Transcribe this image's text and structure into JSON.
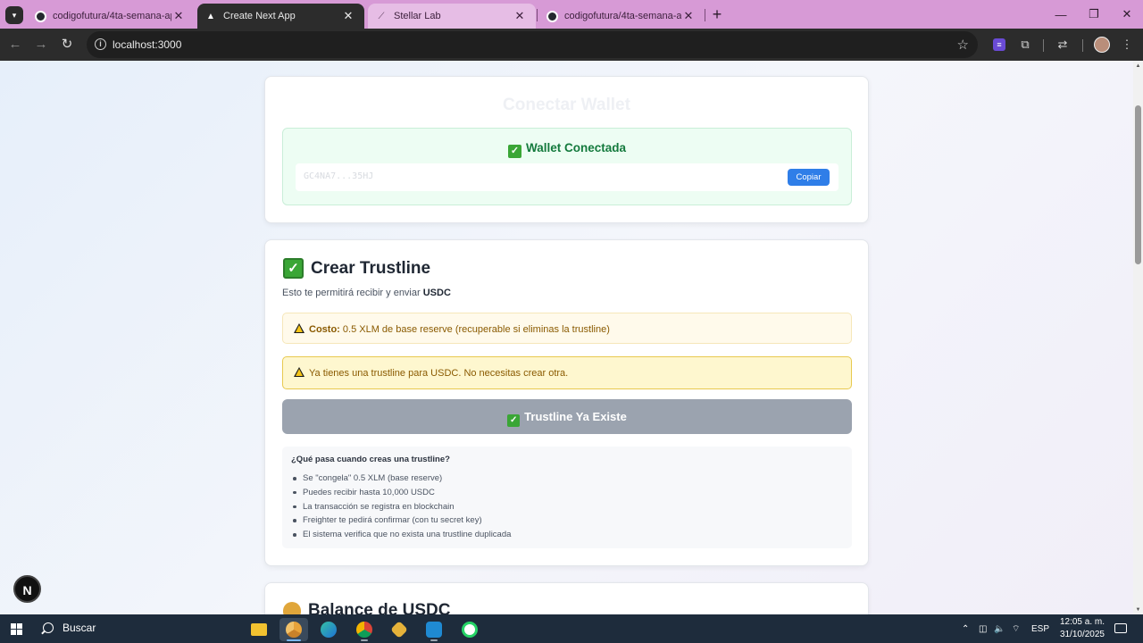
{
  "browser": {
    "tabs": [
      {
        "title": "codigofutura/4ta-semana-aplic",
        "favicon": "github-icon",
        "active": false
      },
      {
        "title": "Create Next App",
        "favicon": "nextjs-triangle-icon",
        "active": true
      },
      {
        "title": "Stellar Lab",
        "favicon": "stellar-icon",
        "active": false
      },
      {
        "title": "codigofutura/4ta-semana-aplic",
        "favicon": "github-icon",
        "active": false
      }
    ],
    "url": "localhost:3000"
  },
  "wallet_card": {
    "title": "Conectar Wallet",
    "status": "Wallet Conectada",
    "address": "GC4NA7...35HJ",
    "copy_label": "Copiar"
  },
  "trustline_card": {
    "title": "Crear Trustline",
    "subtitle_prefix": "Esto te permitirá recibir y enviar",
    "asset": "USDC",
    "cost_label": "Costo:",
    "cost_text": "0.5 XLM de base reserve (recuperable si eliminas la trustline)",
    "warning_text": "Ya tienes una trustline para USDC. No necesitas crear otra.",
    "button_label": "Trustline Ya Existe",
    "info_title": "¿Qué pasa cuando creas una trustline?",
    "info_items": [
      "Se \"congela\" 0.5 XLM (base reserve)",
      "Puedes recibir hasta 10,000 USDC",
      "La transacción se registra en blockchain",
      "Freighter te pedirá confirmar (con tu secret key)",
      "El sistema verifica que no exista una trustline duplicada"
    ]
  },
  "balance_card": {
    "title": "Balance de USDC"
  },
  "next_badge": "N",
  "taskbar": {
    "search_label": "Buscar",
    "language": "ESP",
    "time": "12:05 a. m.",
    "date": "31/10/2025"
  },
  "colors": {
    "tabstrip": "#d79ad6",
    "success_green": "#147a3d",
    "copy_button": "#2f7ee8",
    "disabled_button": "#9ba3af",
    "warning_bg": "#fef7cf"
  }
}
